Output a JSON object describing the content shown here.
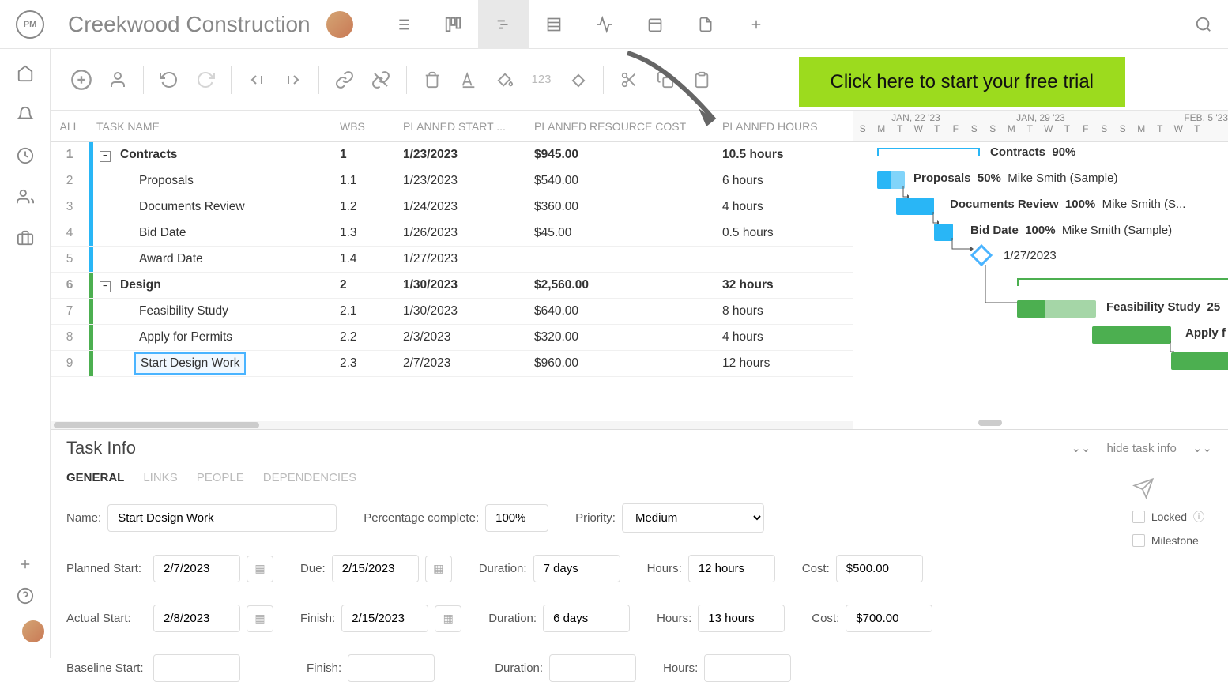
{
  "header": {
    "logo_text": "PM",
    "project": "Creekwood Construction"
  },
  "cta": {
    "label": "Click here to start your free trial"
  },
  "table": {
    "headers": {
      "all": "ALL",
      "name": "TASK NAME",
      "wbs": "WBS",
      "start": "PLANNED START ...",
      "cost": "PLANNED RESOURCE COST",
      "hours": "PLANNED HOURS"
    },
    "rows": [
      {
        "idx": "1",
        "name": "Contracts",
        "wbs": "1",
        "start": "1/23/2023",
        "cost": "$945.00",
        "hours": "10.5 hours",
        "parent": true,
        "color": "#29b6f6"
      },
      {
        "idx": "2",
        "name": "Proposals",
        "wbs": "1.1",
        "start": "1/23/2023",
        "cost": "$540.00",
        "hours": "6 hours",
        "color": "#29b6f6"
      },
      {
        "idx": "3",
        "name": "Documents Review",
        "wbs": "1.2",
        "start": "1/24/2023",
        "cost": "$360.00",
        "hours": "4 hours",
        "color": "#29b6f6"
      },
      {
        "idx": "4",
        "name": "Bid Date",
        "wbs": "1.3",
        "start": "1/26/2023",
        "cost": "$45.00",
        "hours": "0.5 hours",
        "color": "#29b6f6"
      },
      {
        "idx": "5",
        "name": "Award Date",
        "wbs": "1.4",
        "start": "1/27/2023",
        "cost": "",
        "hours": "",
        "color": "#29b6f6"
      },
      {
        "idx": "6",
        "name": "Design",
        "wbs": "2",
        "start": "1/30/2023",
        "cost": "$2,560.00",
        "hours": "32 hours",
        "parent": true,
        "color": "#4caf50"
      },
      {
        "idx": "7",
        "name": "Feasibility Study",
        "wbs": "2.1",
        "start": "1/30/2023",
        "cost": "$640.00",
        "hours": "8 hours",
        "color": "#4caf50"
      },
      {
        "idx": "8",
        "name": "Apply for Permits",
        "wbs": "2.2",
        "start": "2/3/2023",
        "cost": "$320.00",
        "hours": "4 hours",
        "color": "#4caf50"
      },
      {
        "idx": "9",
        "name": "Start Design Work",
        "wbs": "2.3",
        "start": "2/7/2023",
        "cost": "$960.00",
        "hours": "12 hours",
        "color": "#4caf50",
        "selected": true
      }
    ]
  },
  "gantt": {
    "months": [
      "JAN, 22 '23",
      "JAN, 29 '23",
      "FEB, 5 '23"
    ],
    "days": [
      "S",
      "M",
      "T",
      "W",
      "T",
      "F",
      "S",
      "S",
      "M",
      "T",
      "W",
      "T",
      "F",
      "S",
      "S",
      "M",
      "T",
      "W",
      "T"
    ],
    "items": [
      {
        "label": "Contracts",
        "pct": "90%",
        "assignee": ""
      },
      {
        "label": "Proposals",
        "pct": "50%",
        "assignee": "Mike Smith (Sample)"
      },
      {
        "label": "Documents Review",
        "pct": "100%",
        "assignee": "Mike Smith (S..."
      },
      {
        "label": "Bid Date",
        "pct": "100%",
        "assignee": "Mike Smith (Sample)"
      },
      {
        "label": "1/27/2023",
        "pct": "",
        "assignee": ""
      },
      {
        "label": "Feasibility Study",
        "pct": "25",
        "assignee": ""
      },
      {
        "label": "Apply f",
        "pct": "",
        "assignee": ""
      }
    ]
  },
  "taskInfo": {
    "title": "Task Info",
    "hide": "hide task info",
    "tabs": [
      "GENERAL",
      "LINKS",
      "PEOPLE",
      "DEPENDENCIES"
    ],
    "labels": {
      "name": "Name:",
      "pct": "Percentage complete:",
      "priority": "Priority:",
      "pstart": "Planned Start:",
      "due": "Due:",
      "duration": "Duration:",
      "hours": "Hours:",
      "cost": "Cost:",
      "astart": "Actual Start:",
      "finish": "Finish:",
      "bstart": "Baseline Start:",
      "locked": "Locked",
      "milestone": "Milestone"
    },
    "values": {
      "name": "Start Design Work",
      "pct": "100%",
      "priority": "Medium",
      "pstart": "2/7/2023",
      "due": "2/15/2023",
      "duration1": "7 days",
      "hours1": "12 hours",
      "cost1": "$500.00",
      "astart": "2/8/2023",
      "finish": "2/15/2023",
      "duration2": "6 days",
      "hours2": "13 hours",
      "cost2": "$700.00",
      "bstart": "",
      "bfinish": "",
      "bduration": "",
      "bhours": ""
    }
  }
}
